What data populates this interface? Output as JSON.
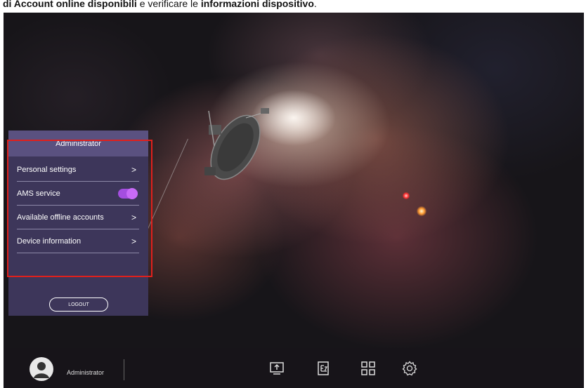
{
  "caption": {
    "bold1": "di Account online disponibili",
    "plain1": " e verificare le ",
    "bold2": "informazioni dispositivo",
    "end": "."
  },
  "menu": {
    "header": "Administrator",
    "items": [
      {
        "label": "Personal settings",
        "control": "chevron"
      },
      {
        "label": "AMS service",
        "control": "toggle",
        "toggle_on": true
      },
      {
        "label": "Available offline accounts",
        "control": "chevron"
      },
      {
        "label": "Device information",
        "control": "chevron"
      }
    ],
    "chevron": ">",
    "logout": "LOGOUT"
  },
  "taskbar": {
    "user": "Administrator",
    "icons": [
      "screen-share-icon",
      "ez-write-icon",
      "apps-grid-icon",
      "settings-gear-icon"
    ]
  },
  "colors": {
    "panel": "#3d365a",
    "header": "#5a5180",
    "toggle": "#a44ee0",
    "highlight": "#e0201c"
  }
}
